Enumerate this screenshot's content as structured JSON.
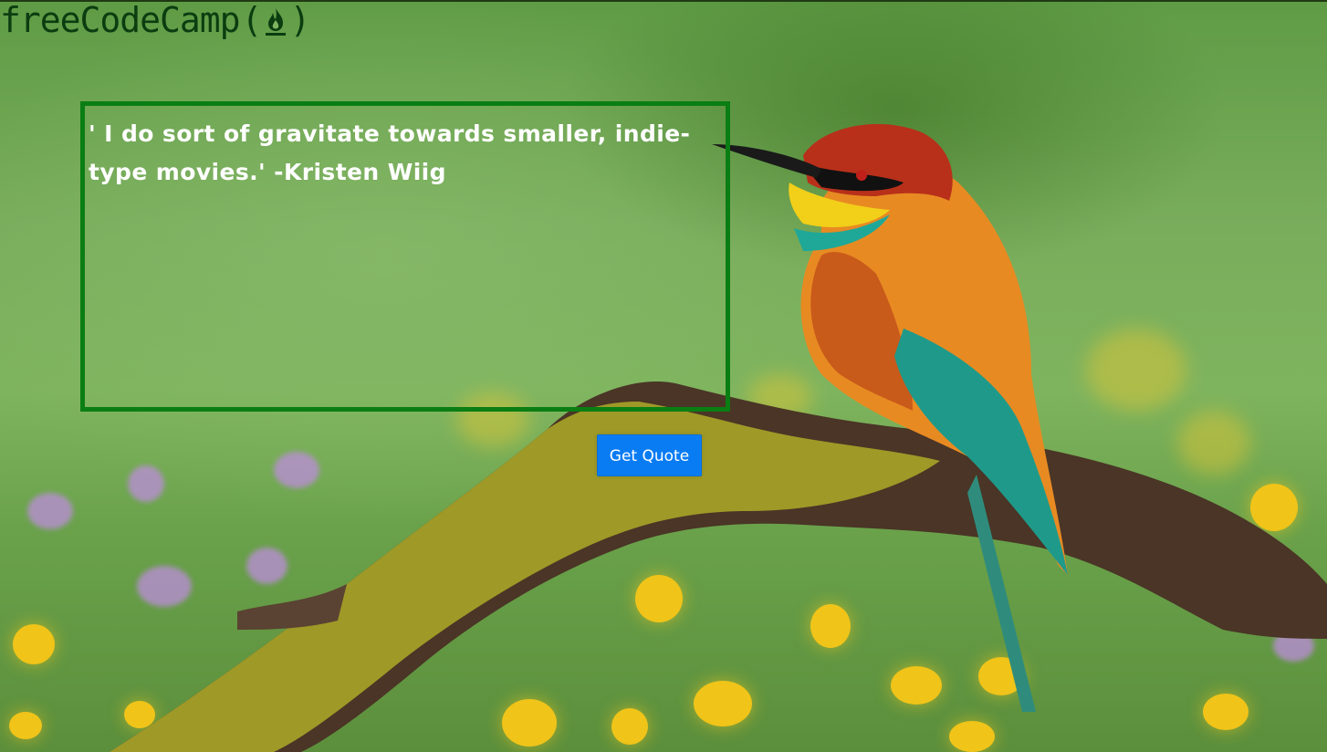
{
  "brand": {
    "name": "freeCodeCamp",
    "open_paren": "(",
    "close_paren": ")",
    "flame_icon": "flame-icon"
  },
  "quote": {
    "text": "' I do sort of gravitate towards smaller, indie-type movies.' -Kristen Wiig"
  },
  "actions": {
    "get_quote_label": "Get Quote"
  },
  "colors": {
    "quote_border": "#0a7d13",
    "button_bg": "#0a7cf3",
    "brand_text": "#0b3d10"
  }
}
